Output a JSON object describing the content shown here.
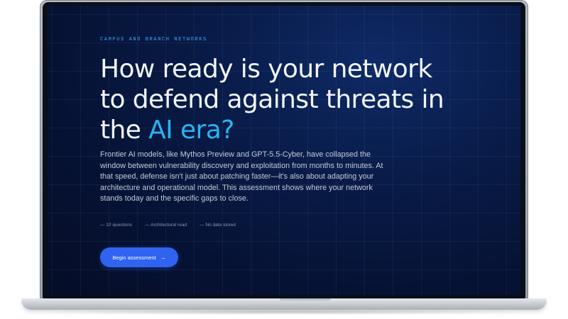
{
  "hero": {
    "eyebrow": "CAMPUS AND BRANCH NETWORKS",
    "headline_line1": "How ready is your network",
    "headline_line2": "to defend against threats in",
    "headline_line3_prefix": "the ",
    "headline_accent": "AI era?",
    "body": "Frontier AI models, like Mythos Preview and GPT-5.5-Cyber, have collapsed the window between vulnerability discovery and exploitation from months to minutes. At that speed, defense isn't just about patching faster—it's also about adapting your architecture and operational model. This assessment shows where your network stands today and the specific gaps to close.",
    "meta": [
      "— 10 questions",
      "— Architectural read",
      "— No data stored"
    ],
    "cta_label": "Begin assessment",
    "cta_icon": "→"
  },
  "colors": {
    "background": "#061234",
    "accent": "#28b4f5",
    "eyebrow": "#3ea6ff",
    "button": "#2f63f0"
  }
}
